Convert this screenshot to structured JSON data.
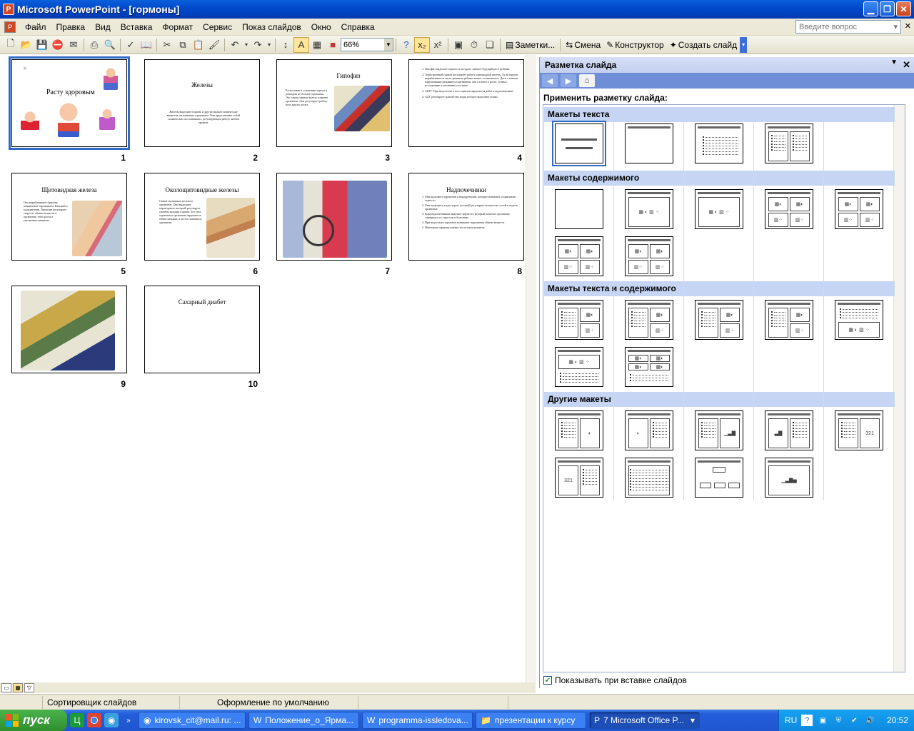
{
  "window": {
    "title": "Microsoft PowerPoint - [гормоны]"
  },
  "menubar": {
    "items": [
      "Файл",
      "Правка",
      "Вид",
      "Вставка",
      "Формат",
      "Сервис",
      "Показ слайдов",
      "Окно",
      "Справка"
    ],
    "help_placeholder": "Введите вопрос"
  },
  "toolbar": {
    "zoom": "66%",
    "notes_label": "Заметки...",
    "transition_label": "Смена",
    "designer_label": "Конструктор",
    "new_slide_label": "Создать слайд"
  },
  "slides": [
    {
      "num": "1",
      "title": "Расту здоровым",
      "selected": true
    },
    {
      "num": "2",
      "title": "Железы",
      "body": "Железы выделяют в кровь и другие жидкие химические вещества, называемые гормонами. Они представляют собой «химических посланников», регулирующих работу многих органов."
    },
    {
      "num": "3",
      "title": "Гипофиз",
      "body": "Расположен в основании черепа и размером не больше горошины. Это самая главная железа в нашем организме. Она регулирует работу всех других желез."
    },
    {
      "num": "4",
      "items": [
        "Гипофиз выделяет гормон от которого зависит будущий рост ребенка.",
        "Тиреотропный гормон регулирует работу щитовидной железы. Если гормон вырабатывается мало, развитие ребенка может остановиться. Дети с такими нарушениями называются кретинами: они отстают в росте, тучные, истощенные и умственно отсталые.",
        "АКТГ. При недостатке этого гормона нарушается работа надпочечников.",
        "АДГ регулирует количество воды, которое выделяют почки."
      ]
    },
    {
      "num": "5",
      "title": "Щитовидная железа",
      "body": "Она вырабатывает гормоны, называемые тироксином. Кальций и кальцитонин. Тироксин регулирует скорость обмена веществ в организме, темп роста и умственное развитие."
    },
    {
      "num": "6",
      "title": "Околощитовидные железы",
      "body": "Самые маленькие железы в организме. Они выделяют паратгормон, который регулирует уровень кальция в крови. Без этих гормонов в организме нарушается обмен кальция, и кости становятся хрупкими."
    },
    {
      "num": "7"
    },
    {
      "num": "8",
      "title": "Надпочечники",
      "items": [
        "Они выделяют адреналин и норадреналин, которые называют «гормонами стресса».",
        "Они выделяют альдостерон, который регулирует количество солей и воды в организме.",
        "Кора надпочечников выделяет кортизол, который помогает организму справиться со стрессом и болезнью.",
        "При недостатке гормонов возникают нарушения обмена веществ.",
        "Некоторые гормоны влияют на половое развитие."
      ]
    },
    {
      "num": "9"
    },
    {
      "num": "10",
      "title": "Сахарный диабет"
    }
  ],
  "task_pane": {
    "title": "Разметка слайда",
    "apply_label": "Применить разметку слайда:",
    "sections": [
      "Макеты текста",
      "Макеты содержимого",
      "Макеты текста и содержимого",
      "Другие макеты"
    ],
    "show_on_insert": "Показывать при вставке слайдов"
  },
  "status": {
    "view": "Сортировщик слайдов",
    "design": "Оформление по умолчанию"
  },
  "taskbar": {
    "start": "пуск",
    "tasks": [
      "kirovsk_cit@mail.ru: ...",
      "Положение_о_Ярма...",
      "programma-issledova...",
      "презентации к курсу",
      "7 Microsoft Office P..."
    ],
    "lang": "RU",
    "time": "20:52"
  },
  "colors": {
    "accent": "#316ac5",
    "titlebar": "#0a5fdc",
    "pane_header": "#c5d5f3",
    "taskbar": "#245edb",
    "start": "#2d8f2d"
  }
}
